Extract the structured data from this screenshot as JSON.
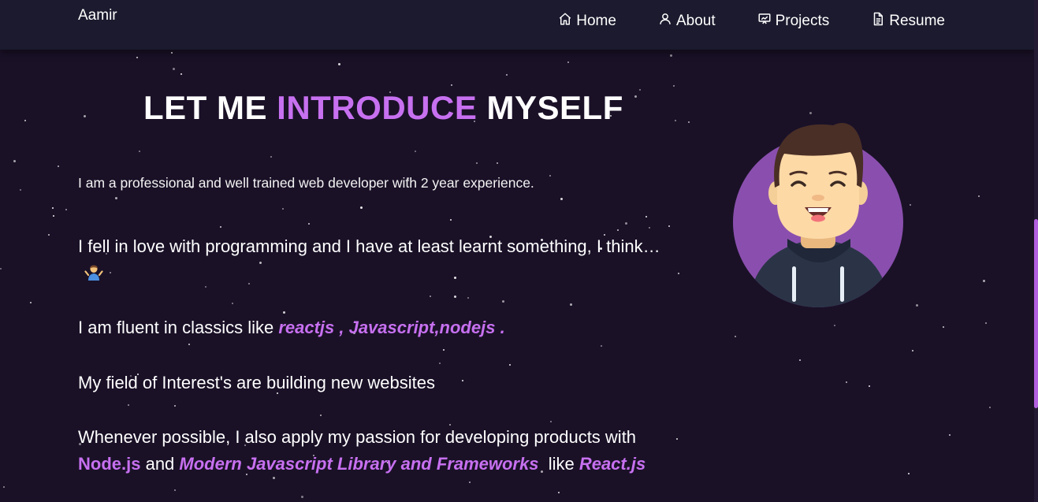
{
  "brand": {
    "name": "Aamir"
  },
  "nav": {
    "items": [
      {
        "label": "Home",
        "icon": "home-icon"
      },
      {
        "label": "About",
        "icon": "user-icon"
      },
      {
        "label": "Projects",
        "icon": "projects-icon"
      },
      {
        "label": "Resume",
        "icon": "document-icon"
      }
    ]
  },
  "about": {
    "heading": {
      "pre": "LET ME ",
      "highlight": "INTRODUCE",
      "post": " MYSELF"
    },
    "intro": "I am a professional and well trained web developer with 2 year experience.",
    "p1": {
      "text": "I fell in love with programming and I have at least learnt something, I think… ",
      "emoji": "person-shrugging-icon"
    },
    "p2": {
      "pre": "I am fluent in classics like ",
      "highlight": "reactjs , Javascript,nodejs ."
    },
    "p3": {
      "text": "My field of Interest's are building new websites"
    },
    "p4": {
      "pre": "Whenever possible, I also apply my passion for developing products with ",
      "node": "Node.js",
      "mid": " and ",
      "frameworks": "Modern Javascript Library and Frameworks",
      "like": "  like ",
      "react": "React.js"
    }
  },
  "avatar": {
    "icon": "avatar-illustration"
  },
  "colors": {
    "background": "#1a1127",
    "navbar": "#1b1a2e",
    "accent": "#c770f0",
    "avatar_circle": "#8a4fae"
  }
}
